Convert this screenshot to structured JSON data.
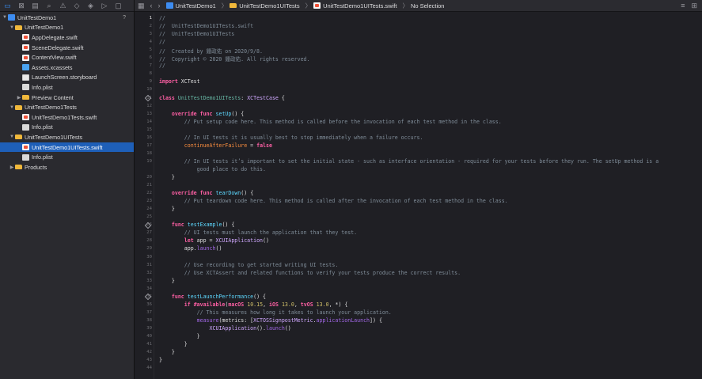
{
  "navigator": {
    "toolbar_icons": [
      "folder-icon",
      "source-control-icon",
      "symbol-icon",
      "find-icon",
      "issue-icon",
      "test-icon",
      "debug-icon",
      "breakpoint-icon",
      "report-icon"
    ],
    "items": [
      {
        "label": "UnitTestDemo1",
        "type": "project",
        "depth": 0,
        "open": true,
        "badge": "?"
      },
      {
        "label": "UnitTestDemo1",
        "type": "folder",
        "depth": 1,
        "open": true
      },
      {
        "label": "AppDelegate.swift",
        "type": "swift",
        "depth": 2
      },
      {
        "label": "SceneDelegate.swift",
        "type": "swift",
        "depth": 2
      },
      {
        "label": "ContentView.swift",
        "type": "swift",
        "depth": 2
      },
      {
        "label": "Assets.xcassets",
        "type": "assets",
        "depth": 2
      },
      {
        "label": "LaunchScreen.storyboard",
        "type": "storyboard",
        "depth": 2
      },
      {
        "label": "Info.plist",
        "type": "plist",
        "depth": 2
      },
      {
        "label": "Preview Content",
        "type": "folder",
        "depth": 2,
        "open": false
      },
      {
        "label": "UnitTestDemo1Tests",
        "type": "folder",
        "depth": 1,
        "open": true
      },
      {
        "label": "UnitTestDemo1Tests.swift",
        "type": "swift",
        "depth": 2
      },
      {
        "label": "Info.plist",
        "type": "plist",
        "depth": 2
      },
      {
        "label": "UnitTestDemo1UITests",
        "type": "folder",
        "depth": 1,
        "open": true
      },
      {
        "label": "UnitTestDemo1UITests.swift",
        "type": "swift",
        "depth": 2,
        "selected": true
      },
      {
        "label": "Info.plist",
        "type": "plist",
        "depth": 2
      },
      {
        "label": "Products",
        "type": "folder",
        "depth": 1,
        "open": false
      }
    ]
  },
  "jumpbar": {
    "crumbs": [
      "UnitTestDemo1",
      "UnitTestDemo1UITests",
      "UnitTestDemo1UITests.swift",
      "No Selection"
    ]
  },
  "editor": {
    "current_line": 1,
    "lines": [
      {
        "n": 1,
        "html": "<span class=\"cm\">//</span>"
      },
      {
        "n": 2,
        "html": "<span class=\"cm\">//  UnitTestDemo1UITests.swift</span>"
      },
      {
        "n": 3,
        "html": "<span class=\"cm\">//  UnitTestDemo1UITests</span>"
      },
      {
        "n": 4,
        "html": "<span class=\"cm\">//</span>"
      },
      {
        "n": 5,
        "html": "<span class=\"cm\">//  Created by 鍾政佑 on 2020/9/8.</span>"
      },
      {
        "n": 6,
        "html": "<span class=\"cm\">//  Copyright © 2020 鍾政佑. All rights reserved.</span>"
      },
      {
        "n": 7,
        "html": "<span class=\"cm\">//</span>"
      },
      {
        "n": 8,
        "html": ""
      },
      {
        "n": 9,
        "html": "<span class=\"kw\">import</span> XCTest"
      },
      {
        "n": 10,
        "html": ""
      },
      {
        "n": 11,
        "html": "<span class=\"kw\">class</span> <span class=\"nm\">UnitTestDemo1UITests</span>: <span class=\"ty\">XCTestCase</span> {",
        "diamond": true
      },
      {
        "n": 12,
        "html": ""
      },
      {
        "n": 13,
        "html": "    <span class=\"kw\">override</span> <span class=\"kw\">func</span> <span class=\"tp\">setUp</span>() {"
      },
      {
        "n": 14,
        "html": "        <span class=\"cm\">// Put setup code here. This method is called before the invocation of each test method in the class.</span>"
      },
      {
        "n": 15,
        "html": ""
      },
      {
        "n": 16,
        "html": "        <span class=\"cm\">// In UI tests it is usually best to stop immediately when a failure occurs.</span>"
      },
      {
        "n": 17,
        "html": "        <span class=\"pr\">continueAfterFailure</span> = <span class=\"kw\">false</span>"
      },
      {
        "n": 18,
        "html": ""
      },
      {
        "n": 19,
        "html": "        <span class=\"cm\">// In UI tests it’s important to set the initial state - such as interface orientation - required for your tests before they run. The setUp method is a</span>"
      },
      {
        "n": "",
        "html": "            <span class=\"cm\">good place to do this.</span>"
      },
      {
        "n": 20,
        "html": "    }"
      },
      {
        "n": 21,
        "html": ""
      },
      {
        "n": 22,
        "html": "    <span class=\"kw\">override</span> <span class=\"kw\">func</span> <span class=\"tp\">tearDown</span>() {"
      },
      {
        "n": 23,
        "html": "        <span class=\"cm\">// Put teardown code here. This method is called after the invocation of each test method in the class.</span>"
      },
      {
        "n": 24,
        "html": "    }"
      },
      {
        "n": 25,
        "html": ""
      },
      {
        "n": 26,
        "html": "    <span class=\"kw\">func</span> <span class=\"tp\">testExample</span>() {",
        "diamond": true
      },
      {
        "n": 27,
        "html": "        <span class=\"cm\">// UI tests must launch the application that they test.</span>"
      },
      {
        "n": 28,
        "html": "        <span class=\"kw\">let</span> app = <span class=\"ty\">XCUIApplication</span>()"
      },
      {
        "n": 29,
        "html": "        app.<span class=\"fn\">launch</span>()"
      },
      {
        "n": 30,
        "html": ""
      },
      {
        "n": 31,
        "html": "        <span class=\"cm\">// Use recording to get started writing UI tests.</span>"
      },
      {
        "n": 32,
        "html": "        <span class=\"cm\">// Use XCTAssert and related functions to verify your tests produce the correct results.</span>"
      },
      {
        "n": 33,
        "html": "    }"
      },
      {
        "n": 34,
        "html": ""
      },
      {
        "n": 35,
        "html": "    <span class=\"kw\">func</span> <span class=\"tp\">testLaunchPerformance</span>() {",
        "diamond": true
      },
      {
        "n": 36,
        "html": "        <span class=\"kw\">if</span> <span class=\"kw\">#available</span>(<span class=\"kw\">macOS</span> <span class=\"nu\">10.15</span>, <span class=\"kw\">iOS</span> <span class=\"nu\">13.0</span>, <span class=\"kw\">tvOS</span> <span class=\"nu\">13.0</span>, *) {"
      },
      {
        "n": 37,
        "html": "            <span class=\"cm\">// This measures how long it takes to launch your application.</span>"
      },
      {
        "n": 38,
        "html": "            <span class=\"fn\">measure</span>(metrics: [<span class=\"ty\">XCTOSSignpostMetric</span>.<span class=\"fn\">applicationLaunch</span>]) {"
      },
      {
        "n": 39,
        "html": "                <span class=\"ty\">XCUIApplication</span>().<span class=\"fn\">launch</span>()"
      },
      {
        "n": 40,
        "html": "            }"
      },
      {
        "n": 41,
        "html": "        }"
      },
      {
        "n": 42,
        "html": "    }"
      },
      {
        "n": 43,
        "html": "}"
      },
      {
        "n": 44,
        "html": ""
      }
    ]
  }
}
